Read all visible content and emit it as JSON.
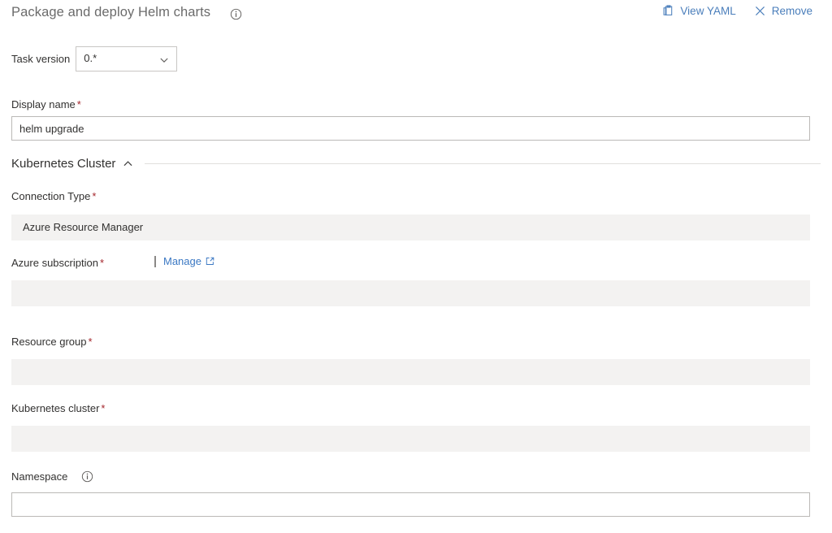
{
  "header": {
    "task_title": "Package and deploy Helm charts",
    "info_icon": "info-circle-icon",
    "actions": [
      {
        "label": "View YAML",
        "icon": "clipboard-icon"
      },
      {
        "label": "Remove",
        "icon": "close-x-icon"
      }
    ]
  },
  "task_version": {
    "label": "Task version",
    "value": "0.*",
    "chevron_icon": "chevron-down-icon"
  },
  "display_name": {
    "label": "Display name",
    "required_marker": "*",
    "value": "helm upgrade",
    "placeholder": ""
  },
  "section": {
    "title": "Kubernetes Cluster",
    "chevron_icon": "chevron-up-icon",
    "expanded": true
  },
  "fields": {
    "connection_type": {
      "label": "Connection Type",
      "required_marker": "*",
      "value": "Azure Resource Manager",
      "disabled": true
    },
    "azure_subscription": {
      "label": "Azure subscription",
      "required_marker": "*",
      "value": "",
      "disabled": true,
      "manage_label": "Manage",
      "manage_icon": "external-link-icon",
      "separator": "|"
    },
    "resource_group": {
      "label": "Resource group",
      "required_marker": "*",
      "value": "",
      "disabled": true
    },
    "kubernetes_cluster": {
      "label": "Kubernetes cluster",
      "required_marker": "*",
      "value": "",
      "disabled": true
    },
    "namespace": {
      "label": "Namespace",
      "info_icon": "info-circle-icon",
      "value": "",
      "placeholder": ""
    }
  },
  "colors": {
    "link": "#3b78c3",
    "required": "#a4262c",
    "disabled_bg": "#f3f2f1",
    "border": "#bbb9b7",
    "title_text": "#6b6b6b",
    "body_text": "#323130"
  }
}
